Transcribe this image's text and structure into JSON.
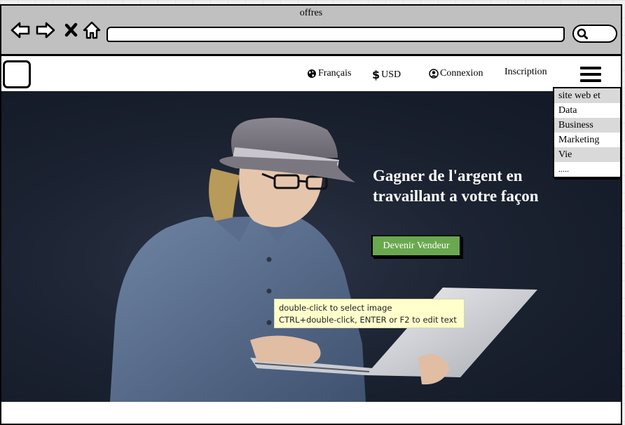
{
  "window": {
    "title": "offres"
  },
  "header": {
    "language": "Français",
    "currency": "USD",
    "login": "Connexion",
    "signup": "Inscription"
  },
  "menu": {
    "items": [
      "site web et",
      "Data",
      "Business",
      "Marketing",
      "Vie",
      "....."
    ]
  },
  "hero": {
    "headline": "Gagner de l'argent en travaillant a votre façon",
    "cta_label": "Devenir Vendeur",
    "tooltip_line1": "double-click to select image",
    "tooltip_line2": "CTRL+double-click, ENTER or F2 to edit text"
  },
  "below_fold": {
    "section_title": ""
  },
  "colors": {
    "cta_green": "#6aa84f",
    "chrome_gray": "#c0c0c0",
    "hero_bg": "#1b2231",
    "tooltip_bg": "#ffffcc"
  },
  "icons": [
    "back-arrow-icon",
    "forward-arrow-icon",
    "close-x-icon",
    "home-icon",
    "search-icon",
    "globe-icon",
    "dollar-icon",
    "user-circle-icon",
    "hamburger-icon"
  ]
}
